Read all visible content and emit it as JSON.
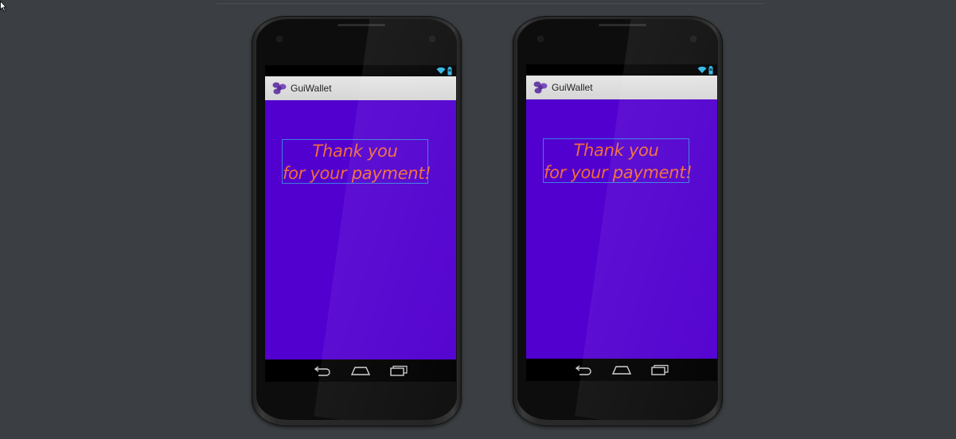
{
  "app": {
    "title": "GuiWallet",
    "icon": "guiwallet-logo-icon"
  },
  "status_bar": {
    "icons": [
      "wifi-icon",
      "battery-icon"
    ]
  },
  "message": {
    "line1": "Thank you",
    "line2": "for your payment!"
  },
  "navigation": {
    "buttons": [
      "back-icon",
      "home-icon",
      "recent-apps-icon"
    ]
  },
  "colors": {
    "background": "#3b3f43",
    "content_background": "#5200cf",
    "message_text": "#f06b3a",
    "message_border": "#3b7de2",
    "action_bar": "#dcdcdc",
    "status_icon": "#33b5e5"
  }
}
